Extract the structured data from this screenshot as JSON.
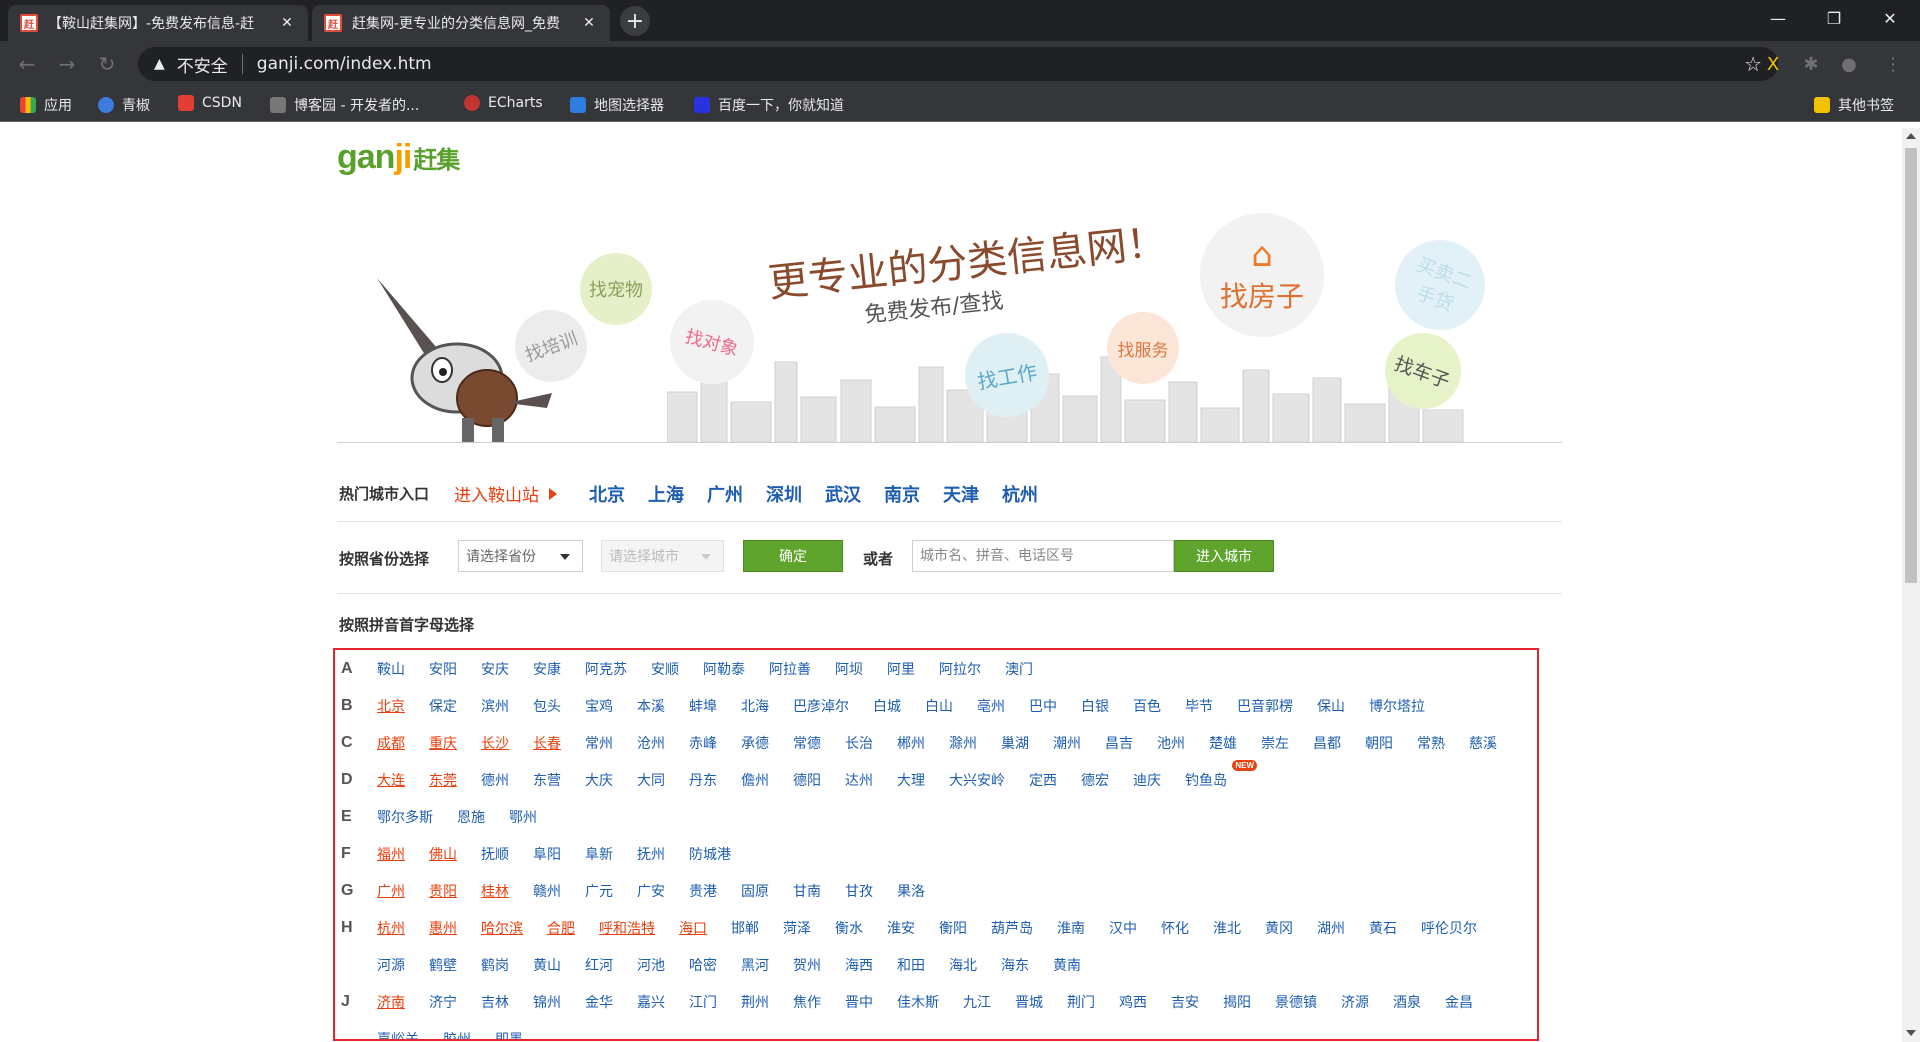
{
  "browser": {
    "tabs": [
      {
        "favicon": "赶",
        "title": "【鞍山赶集网】-免费发布信息-赶"
      },
      {
        "favicon": "赶",
        "title": "赶集网-更专业的分类信息网_免费"
      }
    ],
    "new_tab": "+",
    "address": {
      "security_text": "不安全",
      "url": "ganji.com/index.htm"
    },
    "bookmarks": [
      {
        "label": "应用",
        "color": "#4285f4"
      },
      {
        "label": "青椒",
        "color": "#3d7be0"
      },
      {
        "label": "CSDN",
        "color": "#e33e33"
      },
      {
        "label": "博客园 - 开发者的...",
        "color": "#777777"
      },
      {
        "label": "ECharts",
        "color": "#c23531"
      },
      {
        "label": "地图选择器",
        "color": "#2f7de1"
      },
      {
        "label": "百度一下，你就知道",
        "color": "#2932e1"
      }
    ],
    "other_bookmarks": "其他书签"
  },
  "logo": {
    "text_a": "gan",
    "text_b": "ji",
    "text_cn": "赶集"
  },
  "banner": {
    "slogan": "更专业的分类信息网！",
    "subslogan": "免费发布/查找",
    "bubbles": [
      "找宠物",
      "找培训",
      "找对象",
      "找工作",
      "找服务",
      "找房子",
      "买卖二手货",
      "找车子"
    ]
  },
  "hot": {
    "label": "热门城市入口",
    "enter": "进入鞍山站",
    "cities": [
      "北京",
      "上海",
      "广州",
      "深圳",
      "武汉",
      "南京",
      "天津",
      "杭州"
    ]
  },
  "province": {
    "label": "按照省份选择",
    "province_select": "请选择省份",
    "city_select": "请选择城市",
    "confirm": "确定",
    "or": "或者",
    "input_placeholder": "城市名、拼音、电话区号",
    "enter_city": "进入城市"
  },
  "pinyin_label": "按照拼音首字母选择",
  "letters": [
    {
      "letter": "A",
      "cities": [
        {
          "n": "鞍山"
        },
        {
          "n": "安阳"
        },
        {
          "n": "安庆"
        },
        {
          "n": "安康"
        },
        {
          "n": "阿克苏"
        },
        {
          "n": "安顺"
        },
        {
          "n": "阿勒泰"
        },
        {
          "n": "阿拉善"
        },
        {
          "n": "阿坝"
        },
        {
          "n": "阿里"
        },
        {
          "n": "阿拉尔"
        },
        {
          "n": "澳门"
        }
      ]
    },
    {
      "letter": "B",
      "cities": [
        {
          "n": "北京",
          "hot": true
        },
        {
          "n": "保定"
        },
        {
          "n": "滨州"
        },
        {
          "n": "包头"
        },
        {
          "n": "宝鸡"
        },
        {
          "n": "本溪"
        },
        {
          "n": "蚌埠"
        },
        {
          "n": "北海"
        },
        {
          "n": "巴彦淖尔"
        },
        {
          "n": "白城"
        },
        {
          "n": "白山"
        },
        {
          "n": "亳州"
        },
        {
          "n": "巴中"
        },
        {
          "n": "白银"
        },
        {
          "n": "百色"
        },
        {
          "n": "毕节"
        },
        {
          "n": "巴音郭楞"
        },
        {
          "n": "保山"
        },
        {
          "n": "博尔塔拉"
        }
      ]
    },
    {
      "letter": "C",
      "cities": [
        {
          "n": "成都",
          "hot": true
        },
        {
          "n": "重庆",
          "hot": true
        },
        {
          "n": "长沙",
          "hot": true
        },
        {
          "n": "长春",
          "hot": true
        },
        {
          "n": "常州"
        },
        {
          "n": "沧州"
        },
        {
          "n": "赤峰"
        },
        {
          "n": "承德"
        },
        {
          "n": "常德"
        },
        {
          "n": "长治"
        },
        {
          "n": "郴州"
        },
        {
          "n": "滁州"
        },
        {
          "n": "巢湖"
        },
        {
          "n": "潮州"
        },
        {
          "n": "昌吉"
        },
        {
          "n": "池州"
        },
        {
          "n": "楚雄"
        },
        {
          "n": "崇左"
        },
        {
          "n": "昌都"
        },
        {
          "n": "朝阳"
        },
        {
          "n": "常熟"
        },
        {
          "n": "慈溪"
        }
      ]
    },
    {
      "letter": "D",
      "cities": [
        {
          "n": "大连",
          "hot": true
        },
        {
          "n": "东莞",
          "hot": true
        },
        {
          "n": "德州"
        },
        {
          "n": "东营"
        },
        {
          "n": "大庆"
        },
        {
          "n": "大同"
        },
        {
          "n": "丹东"
        },
        {
          "n": "儋州"
        },
        {
          "n": "德阳"
        },
        {
          "n": "达州"
        },
        {
          "n": "大理"
        },
        {
          "n": "大兴安岭"
        },
        {
          "n": "定西"
        },
        {
          "n": "德宏"
        },
        {
          "n": "迪庆"
        },
        {
          "n": "钓鱼岛",
          "badge": "NEW"
        }
      ]
    },
    {
      "letter": "E",
      "cities": [
        {
          "n": "鄂尔多斯"
        },
        {
          "n": "恩施"
        },
        {
          "n": "鄂州"
        }
      ]
    },
    {
      "letter": "F",
      "cities": [
        {
          "n": "福州",
          "hot": true
        },
        {
          "n": "佛山",
          "hot": true
        },
        {
          "n": "抚顺"
        },
        {
          "n": "阜阳"
        },
        {
          "n": "阜新"
        },
        {
          "n": "抚州"
        },
        {
          "n": "防城港"
        }
      ]
    },
    {
      "letter": "G",
      "cities": [
        {
          "n": "广州",
          "hot": true
        },
        {
          "n": "贵阳",
          "hot": true
        },
        {
          "n": "桂林",
          "hot": true
        },
        {
          "n": "赣州"
        },
        {
          "n": "广元"
        },
        {
          "n": "广安"
        },
        {
          "n": "贵港"
        },
        {
          "n": "固原"
        },
        {
          "n": "甘南"
        },
        {
          "n": "甘孜"
        },
        {
          "n": "果洛"
        }
      ]
    },
    {
      "letter": "H",
      "cities": [
        {
          "n": "杭州",
          "hot": true
        },
        {
          "n": "惠州",
          "hot": true
        },
        {
          "n": "哈尔滨",
          "hot": true
        },
        {
          "n": "合肥",
          "hot": true
        },
        {
          "n": "呼和浩特",
          "hot": true
        },
        {
          "n": "海口",
          "hot": true
        },
        {
          "n": "邯郸"
        },
        {
          "n": "菏泽"
        },
        {
          "n": "衡水"
        },
        {
          "n": "淮安"
        },
        {
          "n": "衡阳"
        },
        {
          "n": "葫芦岛"
        },
        {
          "n": "淮南"
        },
        {
          "n": "汉中"
        },
        {
          "n": "怀化"
        },
        {
          "n": "淮北"
        },
        {
          "n": "黄冈"
        },
        {
          "n": "湖州"
        },
        {
          "n": "黄石"
        },
        {
          "n": "呼伦贝尔"
        }
      ]
    },
    {
      "letter": "",
      "cities": [
        {
          "n": "河源"
        },
        {
          "n": "鹤壁"
        },
        {
          "n": "鹤岗"
        },
        {
          "n": "黄山"
        },
        {
          "n": "红河"
        },
        {
          "n": "河池"
        },
        {
          "n": "哈密"
        },
        {
          "n": "黑河"
        },
        {
          "n": "贺州"
        },
        {
          "n": "海西"
        },
        {
          "n": "和田"
        },
        {
          "n": "海北"
        },
        {
          "n": "海东"
        },
        {
          "n": "黄南"
        }
      ]
    },
    {
      "letter": "J",
      "cities": [
        {
          "n": "济南",
          "hot": true
        },
        {
          "n": "济宁"
        },
        {
          "n": "吉林"
        },
        {
          "n": "锦州"
        },
        {
          "n": "金华"
        },
        {
          "n": "嘉兴"
        },
        {
          "n": "江门"
        },
        {
          "n": "荆州"
        },
        {
          "n": "焦作"
        },
        {
          "n": "晋中"
        },
        {
          "n": "佳木斯"
        },
        {
          "n": "九江"
        },
        {
          "n": "晋城"
        },
        {
          "n": "荆门"
        },
        {
          "n": "鸡西"
        },
        {
          "n": "吉安"
        },
        {
          "n": "揭阳"
        },
        {
          "n": "景德镇"
        },
        {
          "n": "济源"
        },
        {
          "n": "酒泉"
        },
        {
          "n": "金昌"
        }
      ]
    },
    {
      "letter": "",
      "cities": [
        {
          "n": "嘉峪关"
        },
        {
          "n": "胶州"
        },
        {
          "n": "即墨"
        }
      ]
    }
  ]
}
